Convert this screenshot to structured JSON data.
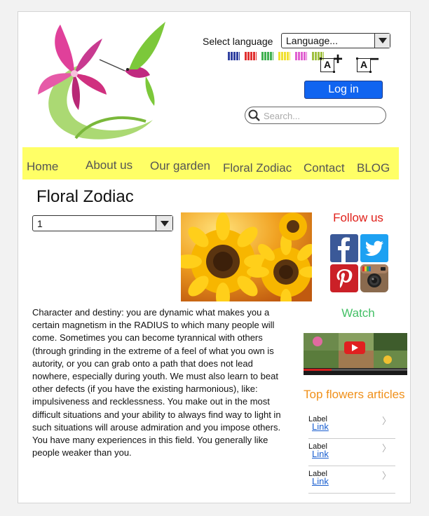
{
  "header": {
    "language_label": "Select language",
    "language_value": "Language...",
    "flag_colors": [
      "#3040a0",
      "#e03030",
      "#40b050",
      "#f0e030",
      "#e060d0",
      "#a0c040"
    ],
    "font_increase_letter": "A",
    "font_increase_sign": "+",
    "font_decrease_letter": "A",
    "font_decrease_sign": "−",
    "login_label": "Log in",
    "search_placeholder": "Search..."
  },
  "nav": {
    "items": [
      "Home",
      "About us",
      "Our garden",
      "Floral Zodiac",
      "Contact",
      "BLOG"
    ]
  },
  "main": {
    "title": "Floral Zodiac",
    "sign_select_value": "1",
    "description": "Character and destiny: you are dynamic what makes you a certain magnetism in the RADIUS to which many people will come. Sometimes you can become tyrannical with others (through grinding in the extreme of a feel of what you own is autority, or you can grab onto a path that does not lead nowhere, especially during youth. We must also learn to beat other defects (if you have the existing harmonious), like: impulsiveness and recklessness. You make out in the most difficult situations and your ability to always find way to light in such situations will arouse admiration and you impose others. You have many experiences in this field. You generally like people weaker than you."
  },
  "sidebar": {
    "follow_title": "Follow us",
    "social": [
      "facebook-icon",
      "twitter-icon",
      "pinterest-icon",
      "instagram-icon"
    ],
    "watch_title": "Watch",
    "top_title": "Top flowers articles",
    "articles": [
      {
        "label": "Label",
        "link": "Link"
      },
      {
        "label": "Label",
        "link": "Link"
      },
      {
        "label": "Label",
        "link": "Link"
      }
    ]
  }
}
